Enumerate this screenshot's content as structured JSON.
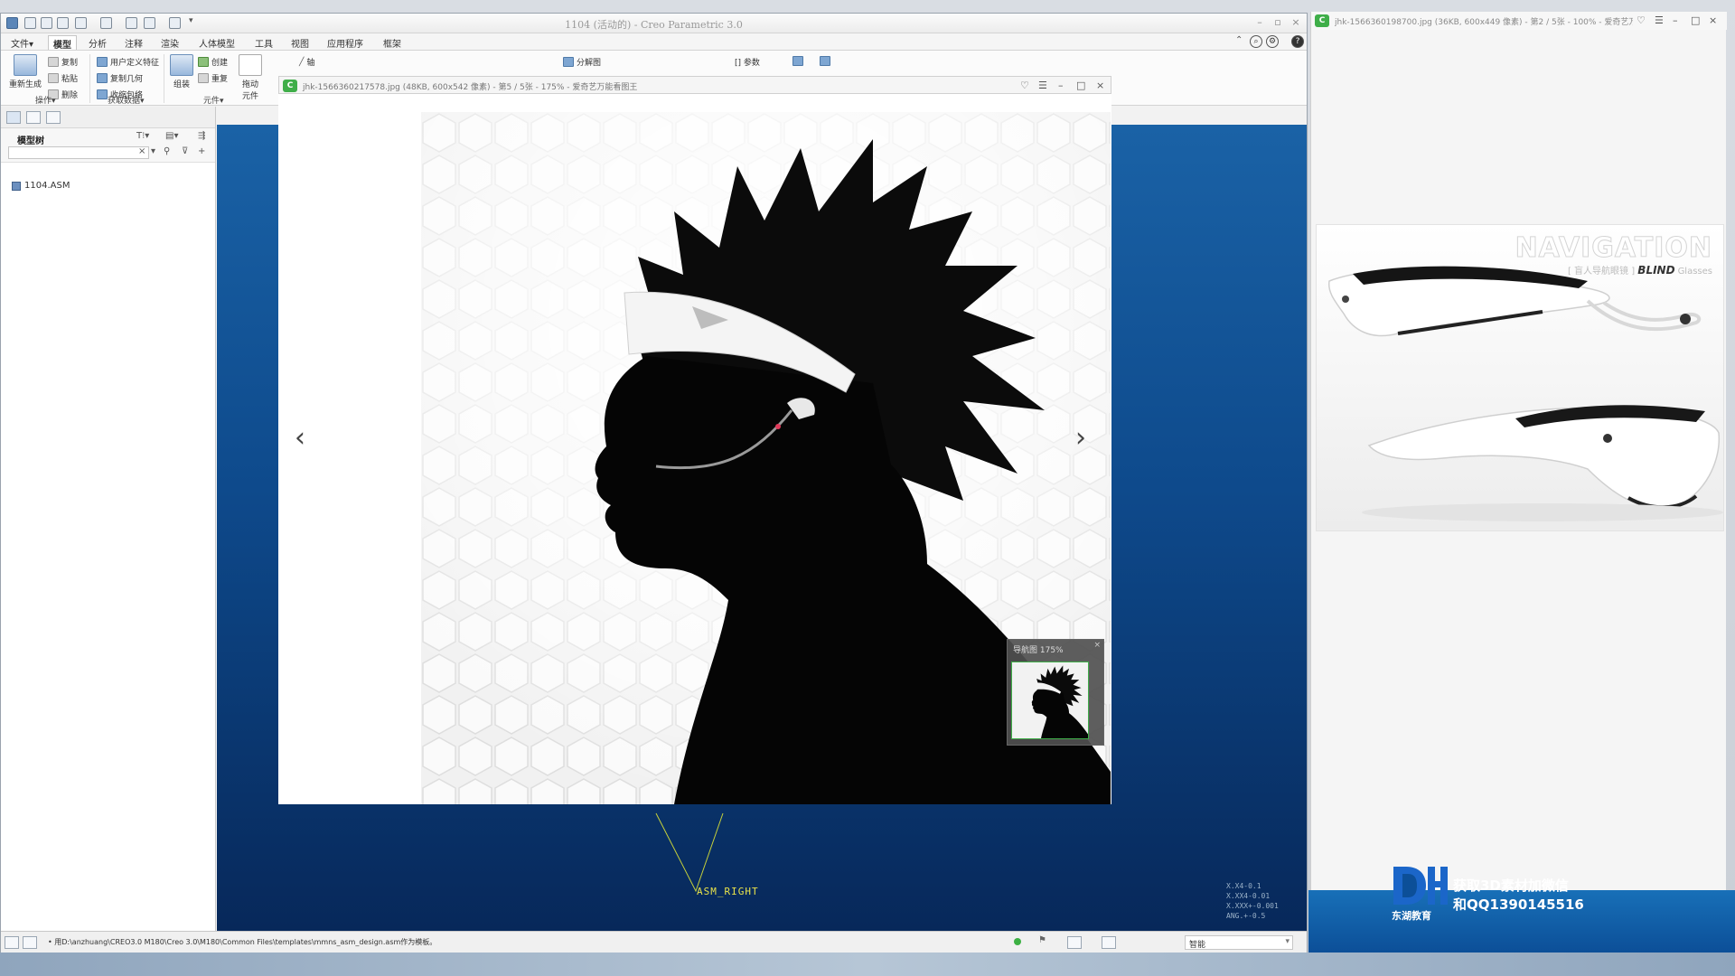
{
  "creo": {
    "title": "1104 (活动的) - Creo Parametric 3.0",
    "menus": [
      "文件▾",
      "模型",
      "分析",
      "注释",
      "渲染",
      "人体模型",
      "工具",
      "视图",
      "应用程序",
      "框架"
    ],
    "active_menu_index": 1,
    "ribbon": {
      "regen_label": "重新生成",
      "copy": "复制",
      "paste": "粘贴",
      "delete": "删除",
      "udf": "用户定义特征",
      "copy_geom": "复制几何",
      "shrinkwrap": "收缩包络",
      "assemble": "组装",
      "create": "创建",
      "repeat": "重复",
      "drag": "拖动",
      "drag2": "元件",
      "axis": "轴",
      "exploded": "分解图",
      "params": "[] 参数",
      "group_ops": "操作▾",
      "group_get_data": "获取数据▾",
      "group_component": "元件▾"
    },
    "model_tree": {
      "title": "模型树",
      "root": "1104.ASM"
    },
    "datum_label": "ASM_RIGHT",
    "coord_readout": [
      "X.X4-0.1",
      "X.XX4-0.01",
      "X.XXX+-0.001",
      "ANG.+-0.5"
    ],
    "status_message": "• 用D:\\anzhuang\\CREO3.0  M180\\Creo 3.0\\M180\\Common Files\\templates\\mmns_asm_design.asm作为模板。",
    "smart_filter": "智能"
  },
  "viewer1": {
    "title": "jhk-1566360217578.jpg (48KB, 600x542 像素) - 第5 / 5张 - 175% - 爱奇艺万能看图王",
    "navigator_title": "导航图  175%",
    "prev_arrow": "‹",
    "next_arrow": "›"
  },
  "viewer2": {
    "title": "jhk-1566360198700.jpg (36KB, 600x449 像素) - 第2 / 5张 - 100% - 爱奇艺万",
    "brand_title": "NAVIGATION",
    "brand_sub_bold": "BLIND",
    "brand_sub_rest": "Glasses",
    "brand_sub_prefix": "[ 盲人导航眼镜 ]"
  },
  "watermark": {
    "line1": "获取3D素材加微信",
    "line2": "和QQ1390145516",
    "brand": "东湖教育"
  },
  "colors": {
    "viewport_top": "#1a62a6",
    "viewport_bottom": "#07285a",
    "datum_yellow": "#e8e24a",
    "viewer_green": "#3fae49"
  }
}
